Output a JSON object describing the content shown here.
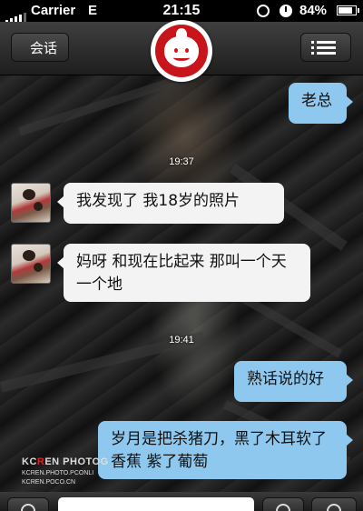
{
  "status_bar": {
    "carrier": "Carrier",
    "network": "E",
    "time": "21:15",
    "battery": "84%",
    "battery_level": 0.84,
    "icons": [
      "signal-icon",
      "rotation-lock-icon",
      "alarm-icon",
      "battery-icon"
    ]
  },
  "nav": {
    "back_label": "会话",
    "menu_icon": "list-icon",
    "avatar_icon": "red-logo-avatar-icon"
  },
  "messages": [
    {
      "type": "out",
      "text": "老总"
    },
    {
      "type": "time",
      "text": "19:37"
    },
    {
      "type": "in",
      "text": "我发现了 我18岁的照片"
    },
    {
      "type": "in",
      "text": "妈呀 和现在比起来 那叫一个天一个地"
    },
    {
      "type": "time",
      "text": "19:41"
    },
    {
      "type": "out",
      "text": "熟话说的好"
    },
    {
      "type": "out",
      "text": "岁月是把杀猪刀，黑了木耳软了香蕉 紫了葡萄"
    }
  ],
  "watermark": {
    "brand_prefix": "KC",
    "brand_highlight": "R",
    "brand_suffix": "EN PHOTOG",
    "line2": "KCREN.PHOTO.PCONLI",
    "line3": "KCREN.POCO.CN"
  },
  "colors": {
    "outgoing_bubble": "#8ec8ef",
    "incoming_bubble": "#f3f3f3",
    "logo_red": "#c8141b"
  }
}
